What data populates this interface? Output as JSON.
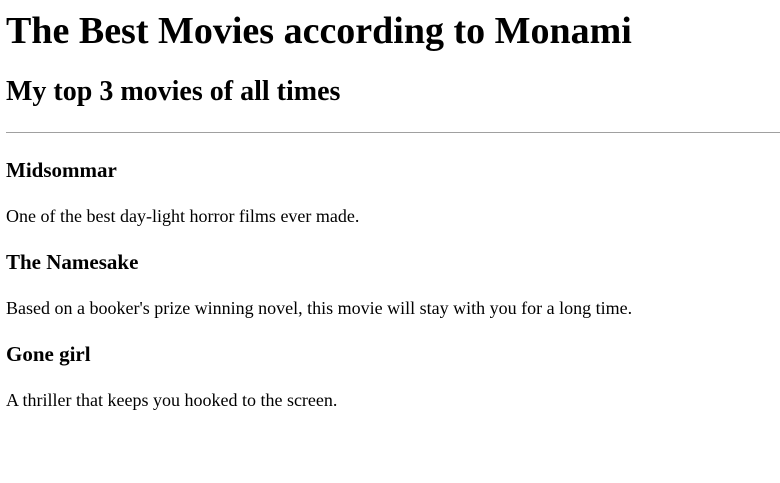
{
  "page": {
    "title": "The Best Movies according to Monami",
    "subtitle": "My top 3 movies of all times"
  },
  "movies": [
    {
      "name": "Midsommar",
      "description": "One of the best day-light horror films ever made."
    },
    {
      "name": "The Namesake",
      "description": "Based on a booker's prize winning novel, this movie will stay with you for a long time."
    },
    {
      "name": "Gone girl",
      "description": "A thriller that keeps you hooked to the screen."
    }
  ]
}
